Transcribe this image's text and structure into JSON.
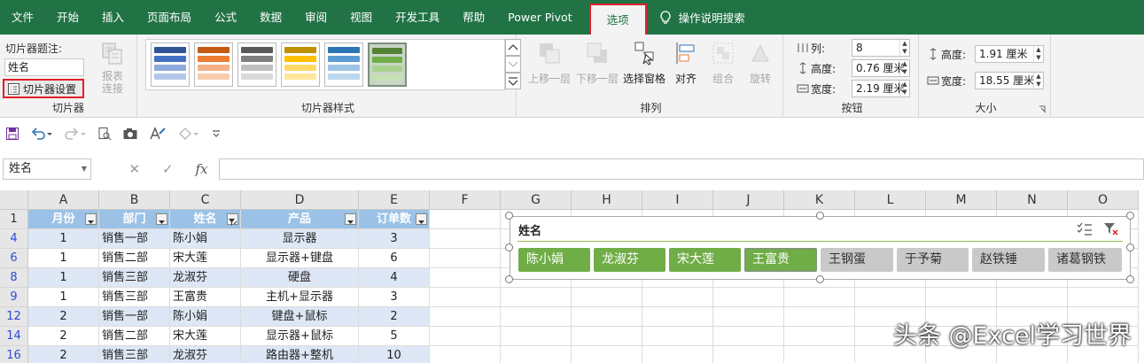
{
  "menu": {
    "tabs": [
      "文件",
      "开始",
      "插入",
      "页面布局",
      "公式",
      "数据",
      "审阅",
      "视图",
      "开发工具",
      "帮助",
      "Power Pivot"
    ],
    "active_tab": "选项",
    "tell_me": "操作说明搜索"
  },
  "ribbon": {
    "slicer_group": {
      "caption_label": "切片器题注:",
      "caption_value": "姓名",
      "settings_label": "切片器设置",
      "report_connections": [
        "报表",
        "连接"
      ],
      "group_label": "切片器"
    },
    "styles_group": {
      "group_label": "切片器样式"
    },
    "arrange_group": {
      "bring_forward": "上移一层",
      "send_backward": "下移一层",
      "selection_pane": "选择窗格",
      "align": "对齐",
      "group": "组合",
      "rotate": "旋转",
      "group_label": "排列"
    },
    "buttons_group": {
      "columns_label": "列:",
      "columns_value": "8",
      "height_label": "高度:",
      "height_value": "0.76 厘米",
      "width_label": "宽度:",
      "width_value": "2.19 厘米",
      "group_label": "按钮"
    },
    "size_group": {
      "height_label": "高度:",
      "height_value": "1.91 厘米",
      "width_label": "宽度:",
      "width_value": "18.55 厘米",
      "group_label": "大小"
    }
  },
  "formula_bar": {
    "name_box": "姓名",
    "fx": "fx"
  },
  "columns": [
    "A",
    "B",
    "C",
    "D",
    "E",
    "F",
    "G",
    "H",
    "I",
    "J",
    "K",
    "L",
    "M",
    "N",
    "O"
  ],
  "table": {
    "headers": [
      "月份",
      "部门",
      "姓名",
      "产品",
      "订单数"
    ],
    "row_numbers": [
      "1",
      "4",
      "6",
      "8",
      "9",
      "12",
      "14",
      "16"
    ],
    "rows": [
      [
        "1",
        "销售一部",
        "陈小娟",
        "显示器",
        "3"
      ],
      [
        "1",
        "销售二部",
        "宋大莲",
        "显示器+键盘",
        "6"
      ],
      [
        "1",
        "销售三部",
        "龙淑芬",
        "硬盘",
        "4"
      ],
      [
        "1",
        "销售三部",
        "王富贵",
        "主机+显示器",
        "3"
      ],
      [
        "2",
        "销售一部",
        "陈小娟",
        "键盘+鼠标",
        "2"
      ],
      [
        "2",
        "销售二部",
        "宋大莲",
        "显示器+鼠标",
        "5"
      ],
      [
        "2",
        "销售三部",
        "龙淑芬",
        "路由器+整机",
        "10"
      ]
    ]
  },
  "slicer": {
    "title": "姓名",
    "items": [
      {
        "label": "陈小娟",
        "selected": true
      },
      {
        "label": "龙淑芬",
        "selected": true
      },
      {
        "label": "宋大莲",
        "selected": true
      },
      {
        "label": "王富贵",
        "selected": true
      },
      {
        "label": "王钢蛋",
        "selected": false
      },
      {
        "label": "于予菊",
        "selected": false
      },
      {
        "label": "赵铁锤",
        "selected": false
      },
      {
        "label": "诸葛钢铁",
        "selected": false
      }
    ]
  },
  "watermark": "头条 @Excel学习世界",
  "colors": {
    "menubar": "#217346",
    "table_header": "#9bc2e6",
    "table_band": "#dde7f5",
    "slicer_selected": "#70ad47",
    "slicer_unselected": "#c9c9c9",
    "highlight": "#e0202a"
  }
}
